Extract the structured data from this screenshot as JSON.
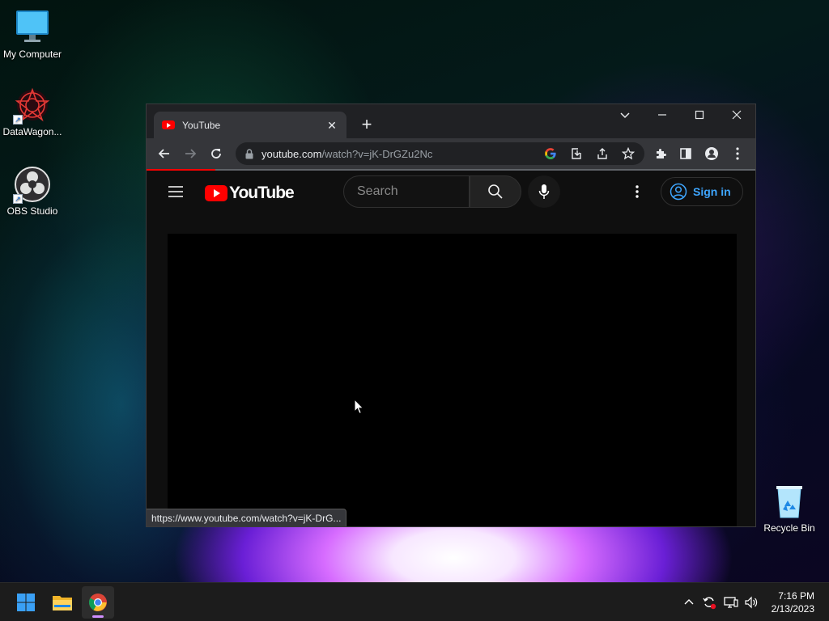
{
  "desktop": {
    "icons": [
      {
        "label": "My Computer"
      },
      {
        "label": "DataWagon..."
      },
      {
        "label": "OBS Studio"
      },
      {
        "label": "Recycle Bin"
      }
    ]
  },
  "browser": {
    "tab_title": "YouTube",
    "url_host": "youtube.com",
    "url_path": "/watch?v=jK-DrGZu2Nc",
    "status_url": "https://www.youtube.com/watch?v=jK-DrG..."
  },
  "youtube": {
    "logo_text": "YouTube",
    "search_placeholder": "Search",
    "signin_label": "Sign in"
  },
  "taskbar": {
    "time": "7:16 PM",
    "date": "2/13/2023"
  },
  "colors": {
    "accent": "#3ea6ff",
    "brand_red": "#ff0000"
  }
}
